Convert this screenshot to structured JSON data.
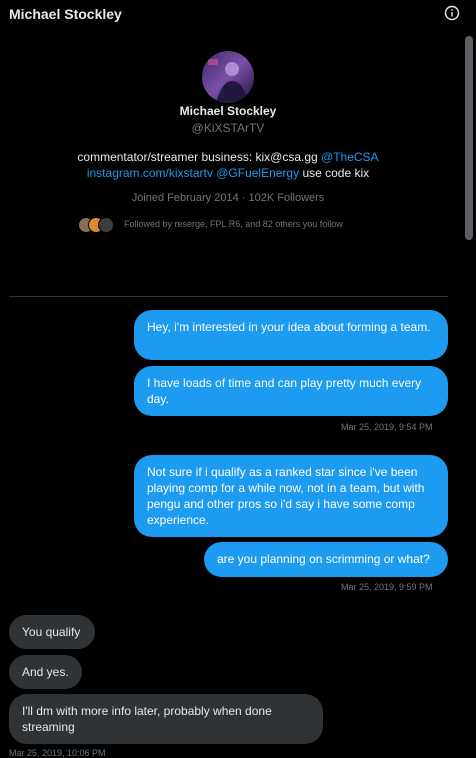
{
  "header": {
    "title": "Michael Stockley"
  },
  "profile": {
    "name": "Michael Stockley",
    "handle": "@KiXSTArTV",
    "bio_line1_text": "commentator/streamer business: kix@csa.gg ",
    "bio_line1_link": "@TheCSA",
    "bio_line2_link1": "instagram.com/kixstartv",
    "bio_line2_link2": "@GFuelEnergy",
    "bio_line2_text": " use code kix",
    "joined": "Joined February 2014 · 102K Followers",
    "followed_by": "Followed by reserge, FPL R6, and 82 others you follow"
  },
  "messages": [
    {
      "text": "Hey, i'm interested in your idea about forming a team."
    },
    {
      "text": "I have loads of time and can play pretty much every day."
    },
    {
      "text": "Not sure if i qualify as a ranked star since i've been playing comp for a while now, not in a team, but with pengu and other pros so i'd say i have some comp experience."
    },
    {
      "text": "are you planning on scrimming or what?"
    },
    {
      "text": "You qualify"
    },
    {
      "text": "And yes."
    },
    {
      "text": "I'll dm with more info later, probably when done streaming"
    }
  ],
  "timestamps": [
    "Mar 25, 2019, 9:54 PM",
    "Mar 25, 2019, 9:59 PM",
    "Mar 25, 2019, 10:06 PM"
  ],
  "colors": {
    "sent_bubble": "#1d9bf0",
    "received_bubble": "#2f3336",
    "link": "#1d9bf0",
    "background": "#000000"
  }
}
